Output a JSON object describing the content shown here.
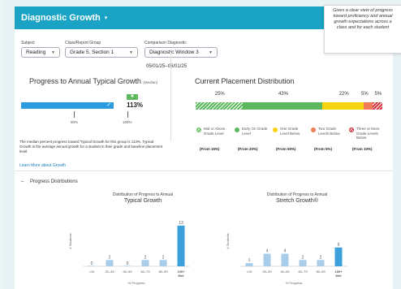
{
  "header": {
    "title": "Diagnostic Growth",
    "caret": "▾"
  },
  "filters": {
    "subject": {
      "label": "Subject",
      "value": "Reading"
    },
    "class_group": {
      "label": "Class/Report Group",
      "value": "Grade 5, Section 1"
    },
    "comparison": {
      "label": "Comparison Diagnostic",
      "value": "Diagnostic Window 3"
    },
    "date_range": "05/01/25–06/01/25"
  },
  "callout": "Gives a clear view of progress toward proficiency and annual growth expectations across a class and for each student",
  "progress": {
    "title": "Progress to Annual Typical Growth",
    "title_suffix": "(Median)",
    "value_label": "113%",
    "value": 113,
    "flag_icon": "star-icon",
    "ticks": [
      "50%",
      "100%"
    ],
    "note": "The median percent progress toward Typical Growth for this group is 113%. Typical Growth is the average annual growth for a student in their grade and baseline placement level.",
    "link": "Learn More about Growth"
  },
  "placement": {
    "title": "Current Placement Distribution",
    "segments": [
      {
        "label": "25%",
        "value": 25,
        "color": "#5cb85c",
        "pattern": true
      },
      {
        "label": "43%",
        "value": 43,
        "color": "#5cb85c",
        "pattern": false
      },
      {
        "label": "22%",
        "value": 22,
        "color": "#f5d40f",
        "pattern": false
      },
      {
        "label": "5%",
        "value": 5,
        "color": "#f07c5a",
        "pattern": false
      },
      {
        "label": "5%",
        "value": 5,
        "color": "#d0373f",
        "pattern": true
      }
    ],
    "legend": [
      {
        "label": "Mid or Above Grade Level",
        "from": "(From 15%)",
        "color": "#5cb85c"
      },
      {
        "label": "Early On Grade Level",
        "from": "(From 20%)",
        "color": "#5cb85c"
      },
      {
        "label": "One Grade Level Below",
        "from": "(From 50%)",
        "color": "#f5d40f"
      },
      {
        "label": "Two Grade Levels Below",
        "from": "(From 5%)",
        "color": "#f07c5a"
      },
      {
        "label": "Three or More Grade Levels Below",
        "from": "(From 10%)",
        "color": "#d0373f"
      }
    ]
  },
  "distributions": {
    "heading": "Progress Distributions",
    "collapse_symbol": "–"
  },
  "chart_data": [
    {
      "type": "bar",
      "title": "Distribution of Progress to Annual",
      "subtitle": "Typical Growth",
      "categories": [
        "<19",
        "20–39",
        "40–59",
        "60–79",
        "80–99",
        "100+ Met"
      ],
      "values": [
        0,
        2,
        0,
        2,
        2,
        13
      ],
      "ylabel": "# Students",
      "xlabel": "% Progress",
      "ylim": [
        0,
        14
      ],
      "color": "#3d9fdb",
      "highlight_color": "#3d9fdb",
      "muted_color": "#a8cdea"
    },
    {
      "type": "bar",
      "title": "Distribution of Progress to Annual",
      "subtitle": "Stretch Growth®",
      "categories": [
        "<19",
        "20–39",
        "40–59",
        "60–79",
        "80–99",
        "100+ Met"
      ],
      "values": [
        1,
        4,
        4,
        2,
        2,
        6
      ],
      "ylabel": "# Students",
      "xlabel": "% Progress",
      "ylim": [
        0,
        14
      ],
      "color": "#3d9fdb",
      "highlight_color": "#3d9fdb",
      "muted_color": "#a8cdea"
    }
  ]
}
